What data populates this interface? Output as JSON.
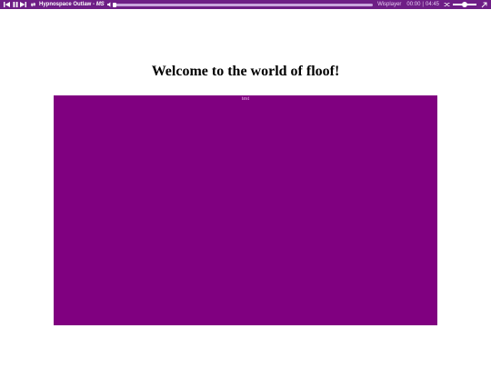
{
  "player": {
    "track_title": "Hypnospace Outlaw - ",
    "track_artist": "MS",
    "player_name": "Wisplayer",
    "time_current": "00:00",
    "time_total": "04:45",
    "seek_progress": 0.0,
    "volume_level": 0.5,
    "colors": {
      "bar_bg": "#6e1e86",
      "text": "#ffffff"
    },
    "icons": [
      "skip-back-icon",
      "pause-icon",
      "skip-forward-icon",
      "repeat-icon",
      "volume-icon",
      "minimize-icon"
    ]
  },
  "page": {
    "title": "Welcome to the world of floof!",
    "panel_label": "test",
    "colors": {
      "page_bg": "#ffffff",
      "panel_bg": "#800080"
    }
  }
}
